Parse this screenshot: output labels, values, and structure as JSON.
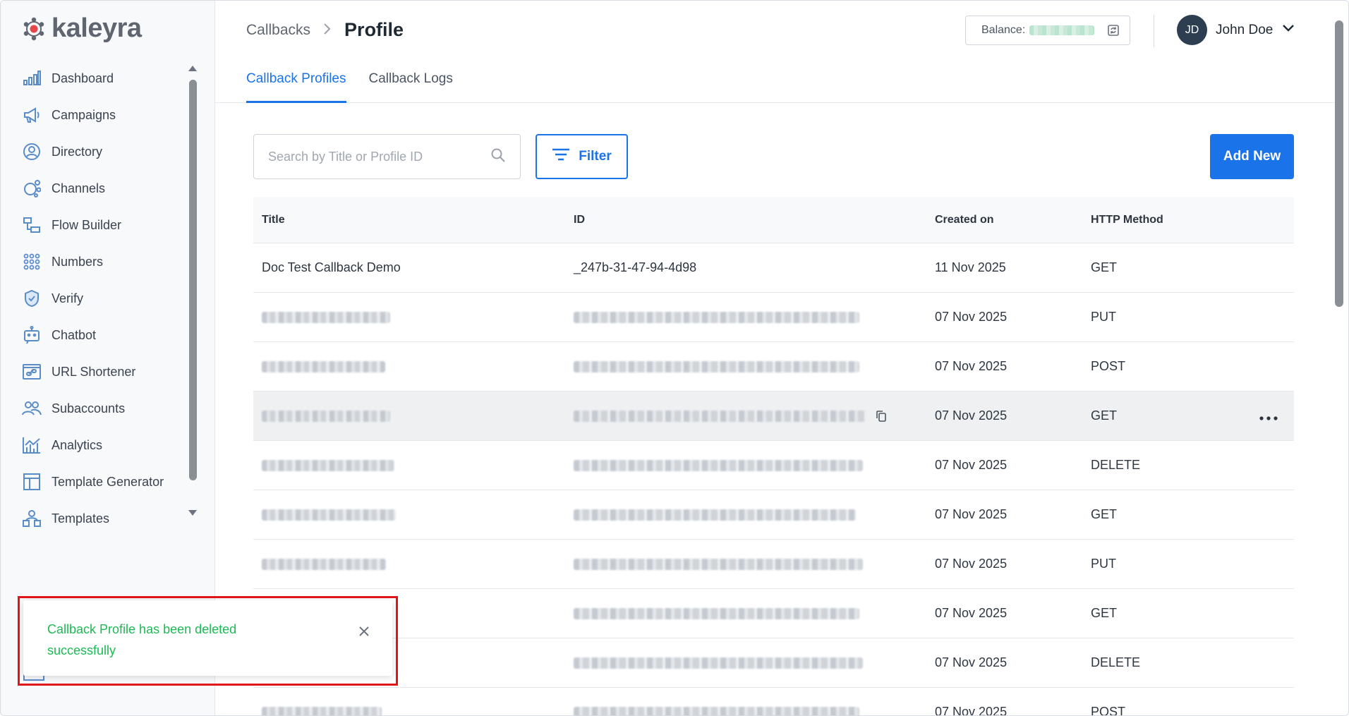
{
  "brand": {
    "name": "kaleyra"
  },
  "sidebar": {
    "items": [
      {
        "label": "Dashboard",
        "icon": "bar-chart-icon"
      },
      {
        "label": "Campaigns",
        "icon": "megaphone-icon"
      },
      {
        "label": "Directory",
        "icon": "user-circle-icon"
      },
      {
        "label": "Channels",
        "icon": "channels-icon"
      },
      {
        "label": "Flow Builder",
        "icon": "flow-icon"
      },
      {
        "label": "Numbers",
        "icon": "dial-pad-icon"
      },
      {
        "label": "Verify",
        "icon": "shield-check-icon"
      },
      {
        "label": "Chatbot",
        "icon": "robot-icon"
      },
      {
        "label": "URL Shortener",
        "icon": "link-icon"
      },
      {
        "label": "Subaccounts",
        "icon": "users-icon"
      },
      {
        "label": "Analytics",
        "icon": "analytics-icon"
      },
      {
        "label": "Template Generator",
        "icon": "layout-icon"
      },
      {
        "label": "Templates",
        "icon": "templates-icon"
      }
    ]
  },
  "header": {
    "breadcrumb_parent": "Callbacks",
    "breadcrumb_current": "Profile",
    "balance_label": "Balance:",
    "user_initials": "JD",
    "user_name": "John Doe"
  },
  "tabs": [
    {
      "label": "Callback Profiles",
      "active": true
    },
    {
      "label": "Callback Logs",
      "active": false
    }
  ],
  "toolbar": {
    "search_placeholder": "Search by Title or Profile ID",
    "filter_label": "Filter",
    "add_label": "Add New"
  },
  "table": {
    "columns": [
      "Title",
      "ID",
      "Created on",
      "HTTP Method"
    ],
    "rows": [
      {
        "title": "Doc Test Callback Demo",
        "id": "_247b-31-47-94-4d98",
        "created": "11 Nov 2025",
        "method": "GET"
      },
      {
        "created": "07 Nov 2025",
        "method": "PUT"
      },
      {
        "created": "07 Nov 2025",
        "method": "POST"
      },
      {
        "created": "07 Nov 2025",
        "method": "GET"
      },
      {
        "created": "07 Nov 2025",
        "method": "DELETE"
      },
      {
        "created": "07 Nov 2025",
        "method": "GET"
      },
      {
        "created": "07 Nov 2025",
        "method": "PUT"
      },
      {
        "created": "07 Nov 2025",
        "method": "GET"
      },
      {
        "created": "07 Nov 2025",
        "method": "DELETE"
      },
      {
        "created": "07 Nov 2025",
        "method": "POST"
      }
    ]
  },
  "toast": {
    "message": "Callback Profile has been deleted successfully"
  },
  "colors": {
    "accent": "#1a73e8",
    "success": "#1db954",
    "highlight": "#e0161b",
    "logo_red": "#e8474a"
  }
}
